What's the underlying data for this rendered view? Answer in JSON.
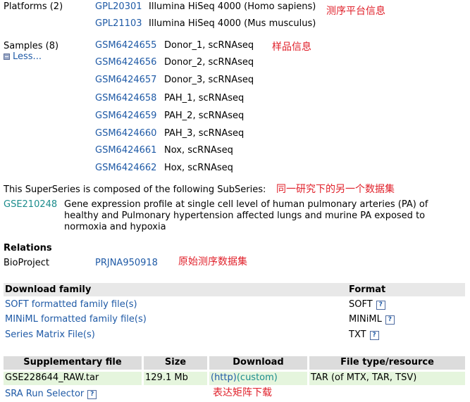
{
  "platforms": {
    "label": "Platforms (2)",
    "items": [
      {
        "id": "GPL20301",
        "desc": "Illumina HiSeq 4000 (Homo sapiens)"
      },
      {
        "id": "GPL21103",
        "desc": "Illumina HiSeq 4000 (Mus musculus)"
      }
    ],
    "annotation": "测序平台信息"
  },
  "samples": {
    "label": "Samples (8)",
    "less_label": "Less...",
    "annotation": "样品信息",
    "items": [
      {
        "id": "GSM6424655",
        "desc": "Donor_1, scRNAseq"
      },
      {
        "id": "GSM6424656",
        "desc": "Donor_2, scRNAseq"
      },
      {
        "id": "GSM6424657",
        "desc": "Donor_3, scRNAseq"
      },
      {
        "id": "GSM6424658",
        "desc": "PAH_1, scRNAseq"
      },
      {
        "id": "GSM6424659",
        "desc": "PAH_2, scRNAseq"
      },
      {
        "id": "GSM6424660",
        "desc": "PAH_3, scRNAseq"
      },
      {
        "id": "GSM6424661",
        "desc": "Nox, scRNAseq"
      },
      {
        "id": "GSM6424662",
        "desc": "Hox, scRNAseq"
      }
    ]
  },
  "superseries": {
    "text": "This SuperSeries is composed of the following SubSeries:",
    "annotation": "同一研究下的另一个数据集",
    "subseries_id": "GSE210248",
    "subseries_desc": "Gene expression profile at single cell level of human pulmonary arteries (PA) of healthy and Pulmonary hypertension affected lungs and murine PA exposed to normoxia and hypoxia"
  },
  "relations": {
    "heading": "Relations",
    "bioproject_label": "BioProject",
    "bioproject_id": "PRJNA950918",
    "annotation": "原始测序数据集"
  },
  "download_family": {
    "header": "Download family",
    "format_header": "Format",
    "rows": [
      {
        "label": "SOFT formatted family file(s)",
        "format": "SOFT"
      },
      {
        "label": "MINiML formatted family file(s)",
        "format": "MINiML"
      },
      {
        "label": "Series Matrix File(s)",
        "format": "TXT"
      }
    ]
  },
  "supplementary": {
    "headers": {
      "file": "Supplementary file",
      "size": "Size",
      "download": "Download",
      "type": "File type/resource"
    },
    "row": {
      "file": "GSE228644_RAW.tar",
      "size": "129.1 Mb",
      "http": "(http)",
      "custom": "(custom)",
      "type": "TAR (of MTX, TAR, TSV)"
    },
    "sra_label": "SRA Run Selector",
    "annotation": "表达矩阵下载"
  },
  "help_glyph": "?",
  "colors": {
    "link": "#1f5aa6",
    "annotation": "#e0202a",
    "teal": "#1b8c8c",
    "header_bg": "#dcdcdc",
    "row_bg": "#e5f5dd"
  }
}
